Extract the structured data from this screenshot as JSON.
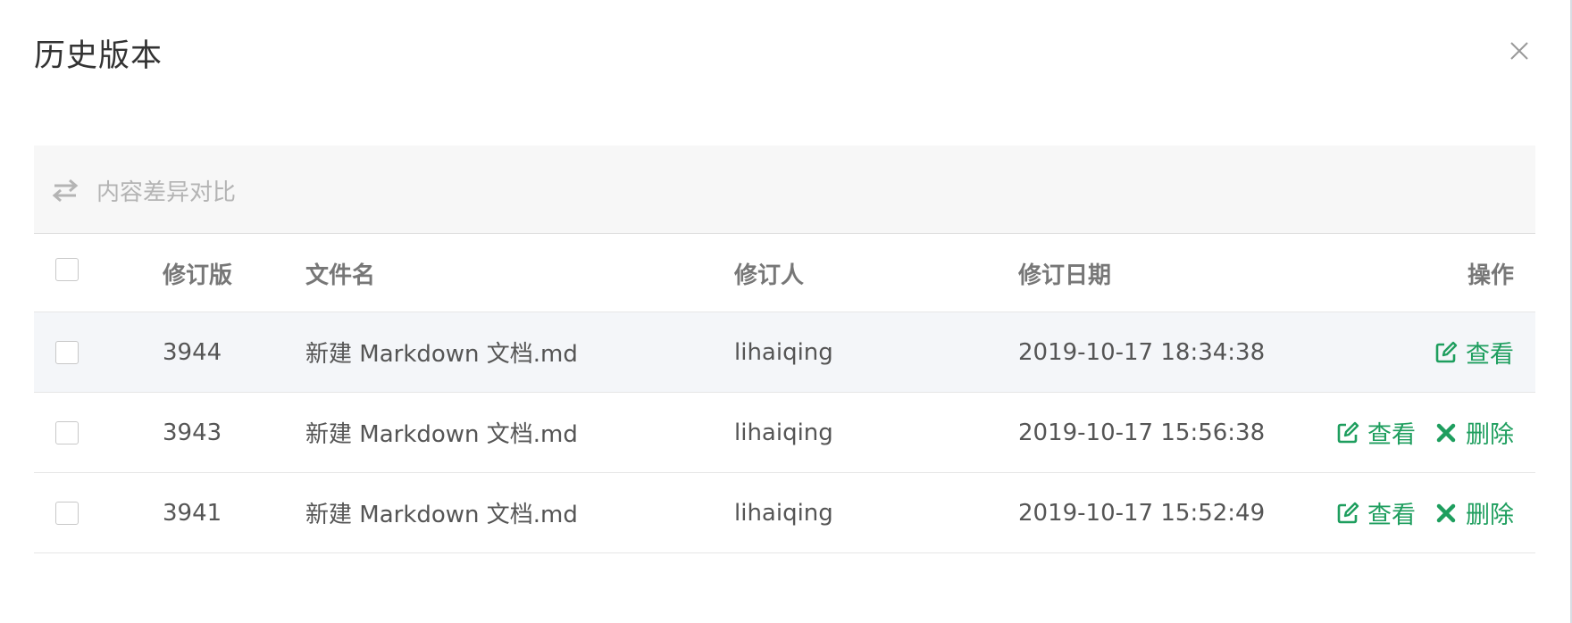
{
  "modal": {
    "title": "历史版本"
  },
  "toolbar": {
    "compare_label": "内容差异对比"
  },
  "table": {
    "headers": {
      "revision": "修订版",
      "filename": "文件名",
      "reviser": "修订人",
      "date": "修订日期",
      "actions": "操作"
    },
    "rows": [
      {
        "revision": "3944",
        "filename": "新建 Markdown 文档.md",
        "reviser": "lihaiqing",
        "date": "2019-10-17 18:34:38",
        "view_label": "查看",
        "delete_label": "",
        "highlighted": true
      },
      {
        "revision": "3943",
        "filename": "新建 Markdown 文档.md",
        "reviser": "lihaiqing",
        "date": "2019-10-17 15:56:38",
        "view_label": "查看",
        "delete_label": "删除"
      },
      {
        "revision": "3941",
        "filename": "新建 Markdown 文档.md",
        "reviser": "lihaiqing",
        "date": "2019-10-17 15:52:49",
        "view_label": "查看",
        "delete_label": "删除"
      }
    ]
  },
  "colors": {
    "action_green": "#1e9e5e",
    "toolbar_bg": "#f7f7f7",
    "highlight_row_bg": "#f4f6f9"
  },
  "icons": {
    "close": "close-icon",
    "compare": "swap-arrows-icon",
    "view": "edit-square-icon",
    "delete": "x-icon"
  }
}
